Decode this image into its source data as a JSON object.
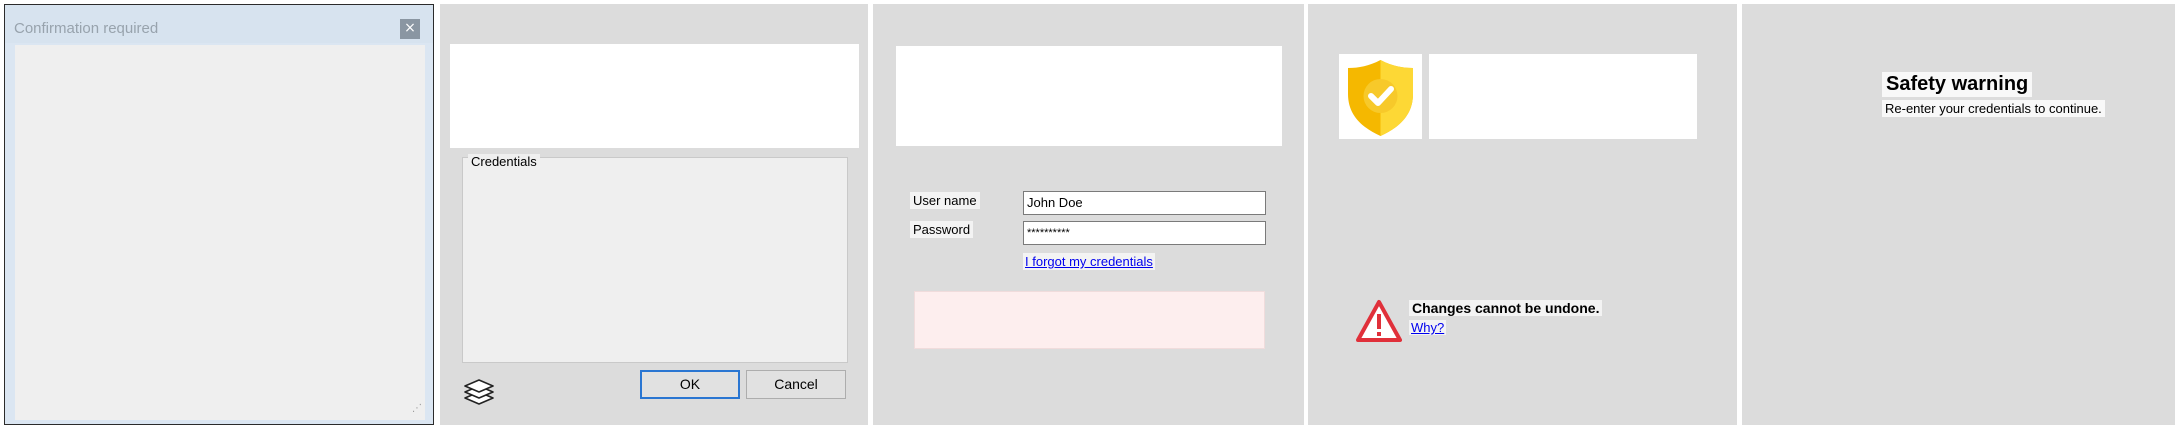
{
  "dialog_window": {
    "title": "Confirmation required",
    "close_glyph": "×",
    "resize_grip_glyph": "⋰"
  },
  "credentials_panel": {
    "group_label": "Credentials",
    "ok_label": "OK",
    "cancel_label": "Cancel",
    "stack_icon": "layers-icon",
    "accent_color": "#2a76d2"
  },
  "login_panel": {
    "user_label": "User name",
    "user_value": "John Doe",
    "password_label": "Password",
    "password_value": "**********",
    "forgot_link": "I forgot my credentials",
    "error_box_color": "#fdeeee"
  },
  "warning_panel": {
    "shield_icon": "shield-check-icon",
    "warning_icon": "warning-triangle-icon",
    "warning_text": "Changes cannot be undone.",
    "why_link": "Why?",
    "shield_color": "#f5c518",
    "warning_color": "#e0303a"
  },
  "safety_panel": {
    "heading": "Safety warning",
    "subtext": "Re-enter your credentials to continue."
  }
}
